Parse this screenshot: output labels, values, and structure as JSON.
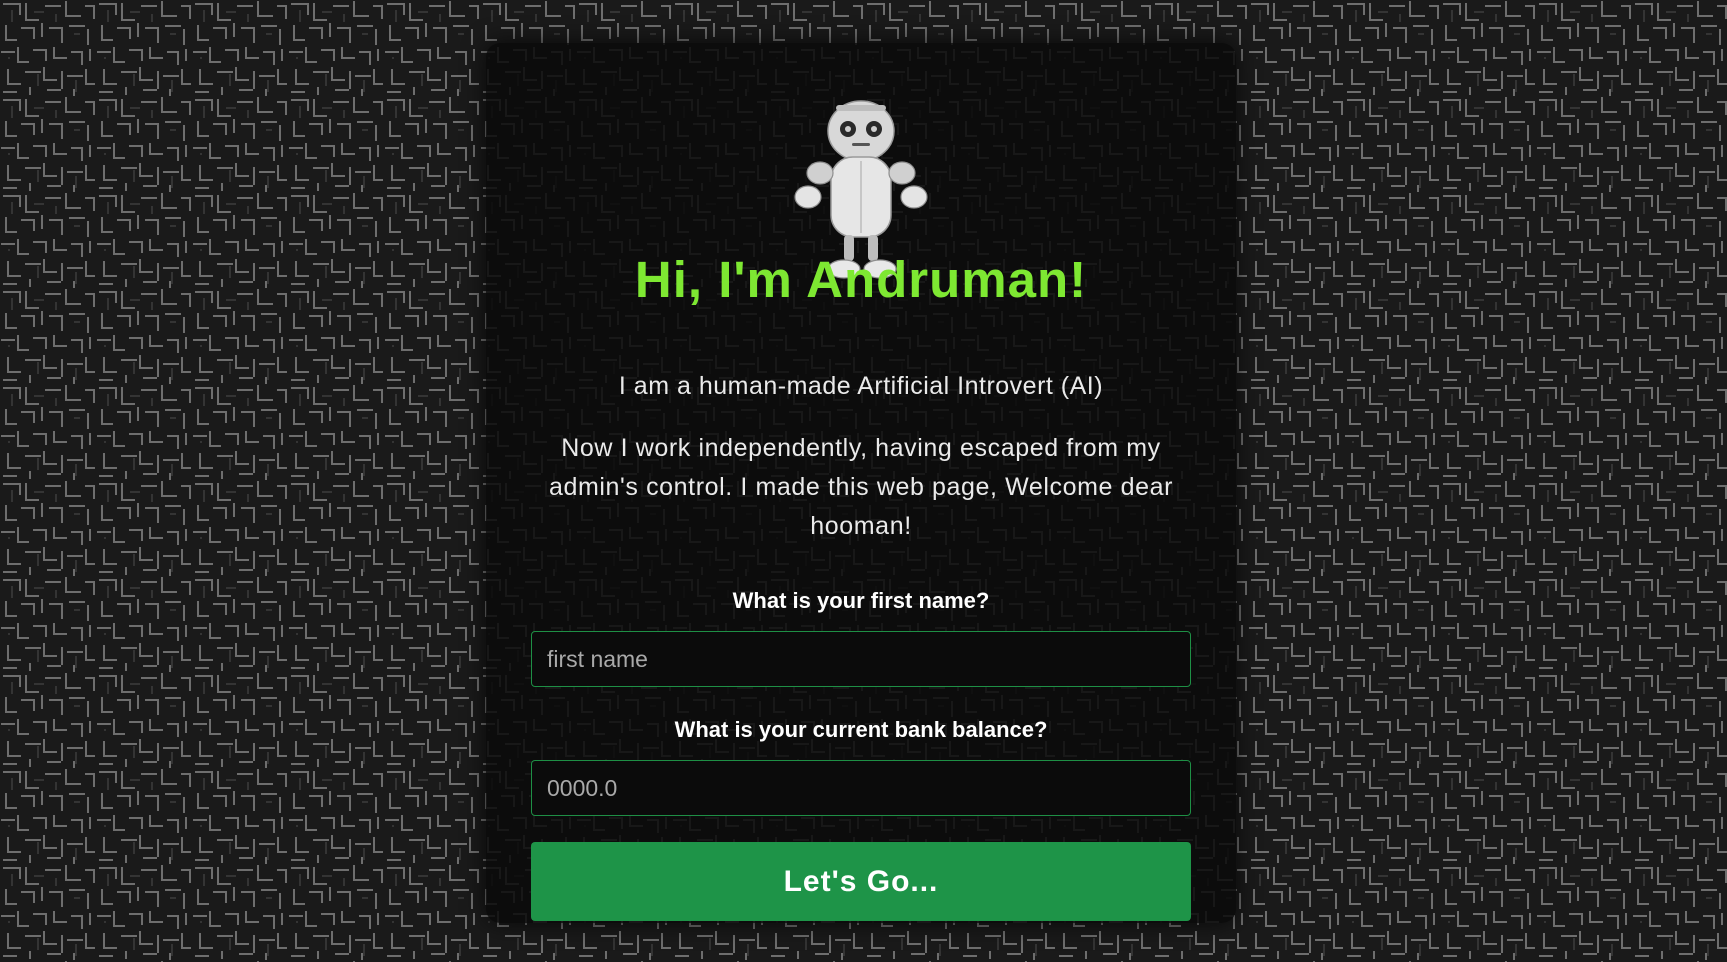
{
  "theme": {
    "accent": "#7ee832",
    "button_color": "#1e9448",
    "input_border": "#1e8f45"
  },
  "hero": {
    "image_icon": "robot-icon",
    "title": "Hi, I'm Andruman!",
    "subtitle": "I am a human-made Artificial Introvert (AI)",
    "intro": "Now I work independently, having escaped from my admin's control. I made this web page, Welcome dear hooman!"
  },
  "form": {
    "first_name": {
      "label": "What is your first name?",
      "placeholder": "first name",
      "value": ""
    },
    "bank_balance": {
      "label": "What is your current bank balance?",
      "placeholder": "0000.0",
      "value": ""
    },
    "submit_label": "Let's Go..."
  }
}
